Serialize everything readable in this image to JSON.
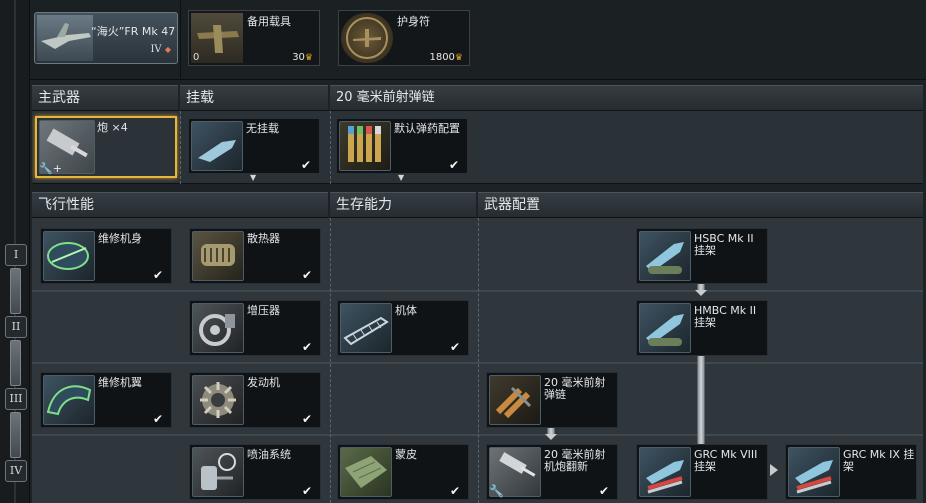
{
  "ranks": [
    "I",
    "II",
    "III",
    "IV"
  ],
  "top": {
    "vehicle": {
      "name": "“海火”FR Mk 47",
      "rank": "IV",
      "icon": "aircraft-spitfire-icon"
    },
    "backup": {
      "label": "备用载具",
      "count": "0",
      "cost": "30",
      "icon": "aircraft-backup-icon"
    },
    "talisman": {
      "label": "护身符",
      "cost": "1800",
      "icon": "talisman-icon"
    }
  },
  "sections": {
    "primary": "主武器",
    "secondary": "挂载",
    "belt": "20 毫米前射弹链",
    "flight": "飞行性能",
    "survival": "生存能力",
    "weapons": "武器配置"
  },
  "weapon_slots": [
    {
      "label": "炮 ×4",
      "icon": "cannon-icon",
      "selected": true
    },
    {
      "label": "无挂载",
      "icon": "empty-pylon-icon",
      "checked": true
    },
    {
      "label": "默认弹药配置",
      "icon": "ammo-belt-icon",
      "checked": true
    }
  ],
  "mods": {
    "repair_fuselage": {
      "label": "维修机身",
      "icon": "fuselage-repair-icon"
    },
    "radiator": {
      "label": "散热器",
      "icon": "radiator-icon"
    },
    "hsbc": {
      "label": "HSBC Mk II 挂架",
      "icon": "bomb-rack-icon"
    },
    "supercharger": {
      "label": "增压器",
      "icon": "supercharger-icon"
    },
    "airframe": {
      "label": "机体",
      "icon": "airframe-icon"
    },
    "hmbc": {
      "label": "HMBC Mk II 挂架",
      "icon": "bomb-rack-icon"
    },
    "repair_wing": {
      "label": "维修机翼",
      "icon": "wing-repair-icon"
    },
    "engine": {
      "label": "发动机",
      "icon": "engine-icon"
    },
    "belt_20mm": {
      "label": "20 毫米前射弹链",
      "icon": "ammo-belt-icon"
    },
    "injection": {
      "label": "喷油系统",
      "icon": "injection-icon"
    },
    "cover": {
      "label": "蒙皮",
      "icon": "skin-cover-icon"
    },
    "cannon_refit": {
      "label": "20 毫米前射机炮翻新",
      "icon": "cannon-refit-icon"
    },
    "grc8": {
      "label": "GRC Mk VIII 挂架",
      "icon": "rocket-rack-icon"
    },
    "grc9": {
      "label": "GRC Mk IX 挂架",
      "icon": "rocket-rack-icon"
    }
  }
}
